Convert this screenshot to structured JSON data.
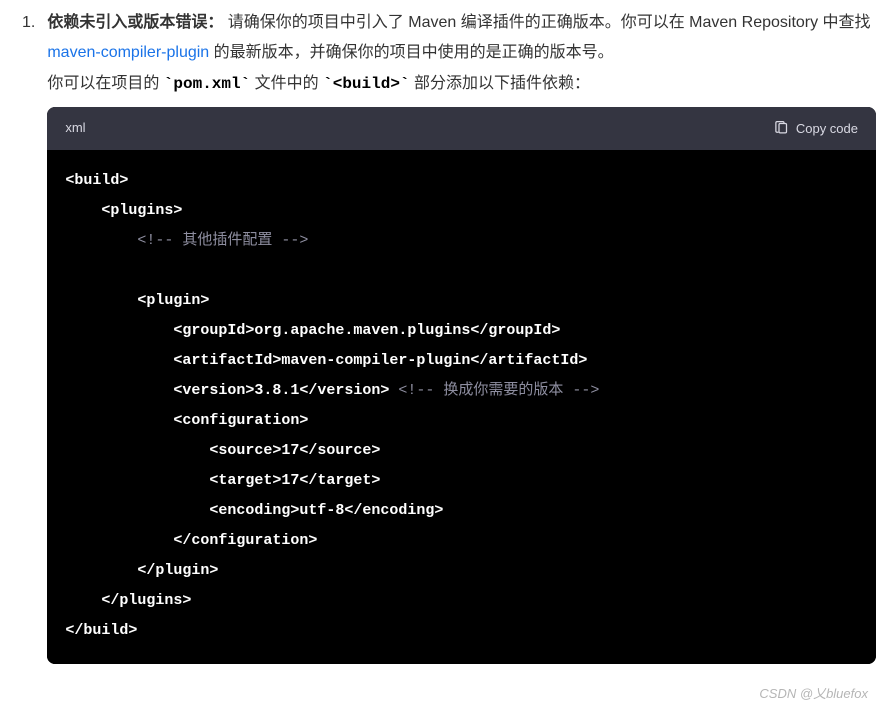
{
  "list": {
    "number": "1.",
    "title_bold": "依赖未引入或版本错误：",
    "para1_before_link": "  请确保你的项目中引入了 Maven 编译插件的正确版本。你可以在 Maven Repository 中查找 ",
    "link_text": "maven-compiler-plugin",
    "para1_after_link": " 的最新版本，并确保你的项目中使用的是正确的版本号。",
    "para2_prefix": "你可以在项目的 ",
    "code1": "`pom.xml`",
    "para2_mid": " 文件中的 ",
    "code2": "`<build>`",
    "para2_suffix": " 部分添加以下插件依赖："
  },
  "codeblock": {
    "lang": "xml",
    "copy_label": "Copy code",
    "lines": {
      "l1": "<build>",
      "l2": "    <plugins>",
      "l3_indent": "        ",
      "l3_comment": "<!-- 其他插件配置 -->",
      "l4": "",
      "l5": "        <plugin>",
      "l6": "            <groupId>org.apache.maven.plugins</groupId>",
      "l7": "            <artifactId>maven-compiler-plugin</artifactId>",
      "l8a": "            <version>3.8.1</version>",
      "l8b_comment": " <!-- 换成你需要的版本 -->",
      "l9": "            <configuration>",
      "l10": "                <source>17</source>",
      "l11": "                <target>17</target>",
      "l12": "                <encoding>utf-8</encoding>",
      "l13": "            </configuration>",
      "l14": "        </plugin>",
      "l15": "    </plugins>",
      "l16": "</build>"
    }
  },
  "watermark": "CSDN @乂bluefox"
}
